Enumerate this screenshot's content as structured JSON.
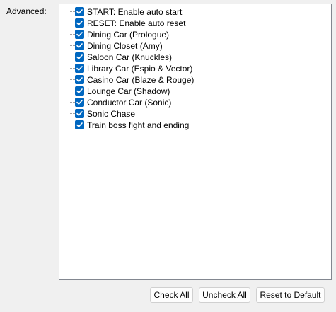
{
  "advanced_label": "Advanced:",
  "tree": {
    "items": [
      {
        "label": "START: Enable auto start",
        "checked": true
      },
      {
        "label": "RESET: Enable auto reset",
        "checked": true
      },
      {
        "label": "Dining Car (Prologue)",
        "checked": true
      },
      {
        "label": "Dining Closet (Amy)",
        "checked": true
      },
      {
        "label": "Saloon Car (Knuckles)",
        "checked": true
      },
      {
        "label": "Library Car (Espio & Vector)",
        "checked": true
      },
      {
        "label": "Casino Car (Blaze & Rouge)",
        "checked": true
      },
      {
        "label": "Lounge Car (Shadow)",
        "checked": true
      },
      {
        "label": "Conductor Car (Sonic)",
        "checked": true
      },
      {
        "label": "Sonic Chase",
        "checked": true
      },
      {
        "label": "Train boss fight and ending",
        "checked": true
      }
    ]
  },
  "buttons": {
    "check_all": "Check All",
    "uncheck_all": "Uncheck All",
    "reset_default": "Reset to Default"
  },
  "colors": {
    "checkbox_accent": "#0067c0",
    "window_background": "#f0f0f0",
    "tree_border": "#828790"
  },
  "icons": {
    "checkbox": "checkmark-icon"
  }
}
